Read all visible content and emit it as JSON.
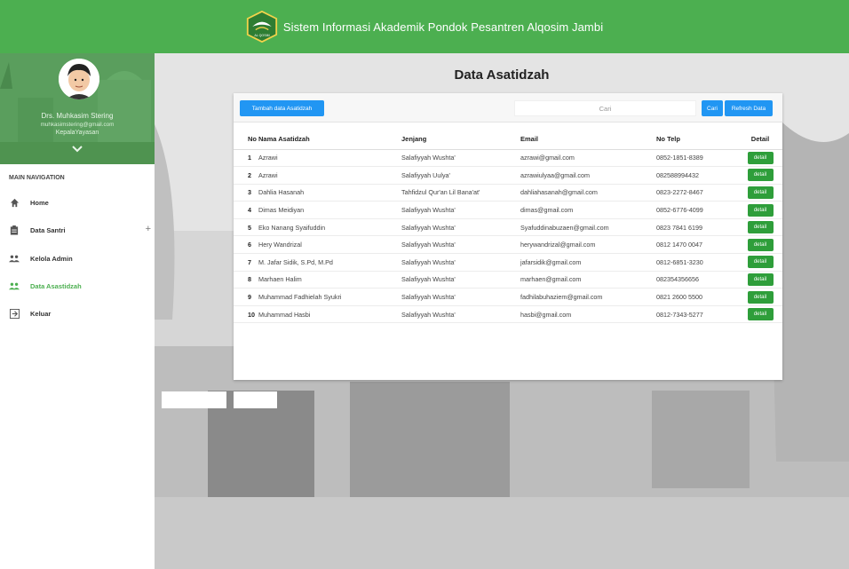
{
  "header": {
    "title": "Sistem Informasi Akademik Pondok Pesantren Alqosim Jambi",
    "logo_text": "AL QOSIM"
  },
  "profile": {
    "name": "Drs. Muhkasim Stering",
    "email": "muhkasimstering@gmail.com",
    "role": "KepalaYayasan"
  },
  "sidebar": {
    "heading": "MAIN NAVIGATION",
    "items": [
      {
        "label": "Home",
        "icon": "home-icon"
      },
      {
        "label": "Data Santri",
        "icon": "clipboard-icon",
        "expand": "+"
      },
      {
        "label": "Kelola Admin",
        "icon": "users-icon"
      },
      {
        "label": "Data Asastidzah",
        "icon": "users-icon",
        "active": true
      },
      {
        "label": "Keluar",
        "icon": "logout-icon"
      }
    ]
  },
  "page": {
    "title": "Data Asatidzah"
  },
  "toolbar": {
    "add_label": "Tambah data Asatidzah",
    "search_placeholder": "Cari",
    "search_button": "Cari",
    "refresh_button": "Refresh Data"
  },
  "table": {
    "columns": [
      "No",
      "Nama Asatidzah",
      "Jenjang",
      "Email",
      "No Telp",
      "Detail"
    ],
    "detail_label": "detail",
    "rows": [
      {
        "no": "1",
        "nama": "Azrawi",
        "jenjang": "Salafiyyah Wushta'",
        "email": "azrawi@gmail.com",
        "telp": "0852-1851-8389"
      },
      {
        "no": "2",
        "nama": "Azrawi",
        "jenjang": "Salafiyyah Uulya'",
        "email": "azrawiulyaa@gmail.com",
        "telp": "082588994432"
      },
      {
        "no": "3",
        "nama": "Dahlia Hasanah",
        "jenjang": "Tahfidzul Qur'an Lil Bana'at'",
        "email": "dahliahasanah@gmail.com",
        "telp": "0823-2272-8467"
      },
      {
        "no": "4",
        "nama": "Dimas Meidiyan",
        "jenjang": "Salafiyyah Wushta'",
        "email": "dimas@gmail.com",
        "telp": "0852-6776-4099"
      },
      {
        "no": "5",
        "nama": "Eko Nanang Syaifuddin",
        "jenjang": "Salafiyyah Wushta'",
        "email": "Syafuddinabuzaen@gmail.com",
        "telp": "0823 7841 6199"
      },
      {
        "no": "6",
        "nama": "Hery Wandrizal",
        "jenjang": "Salafiyyah Wushta'",
        "email": "herywandrizal@gmail.com",
        "telp": "0812 1470 0047"
      },
      {
        "no": "7",
        "nama": "M. Jafar Sidik, S.Pd, M.Pd",
        "jenjang": "Salafiyyah Wushta'",
        "email": "jafarsidik@gmail.com",
        "telp": "0812-6851-3230"
      },
      {
        "no": "8",
        "nama": "Marhaen Halim",
        "jenjang": "Salafiyyah Wushta'",
        "email": "marhaen@gmail.com",
        "telp": "082354356656"
      },
      {
        "no": "9",
        "nama": "Muhammad Fadhielah Syukri",
        "jenjang": "Salafiyyah Wushta'",
        "email": "fadhilabuhaziem@gmail.com",
        "telp": "0821 2600 5500"
      },
      {
        "no": "10",
        "nama": "Muhammad Hasbi",
        "jenjang": "Salafiyyah Wushta'",
        "email": "hasbi@gmail.com",
        "telp": "0812-7343-5277"
      }
    ]
  },
  "colors": {
    "brand_green": "#4caf50",
    "button_blue": "#2196f3",
    "detail_green": "#2e9e3a"
  }
}
